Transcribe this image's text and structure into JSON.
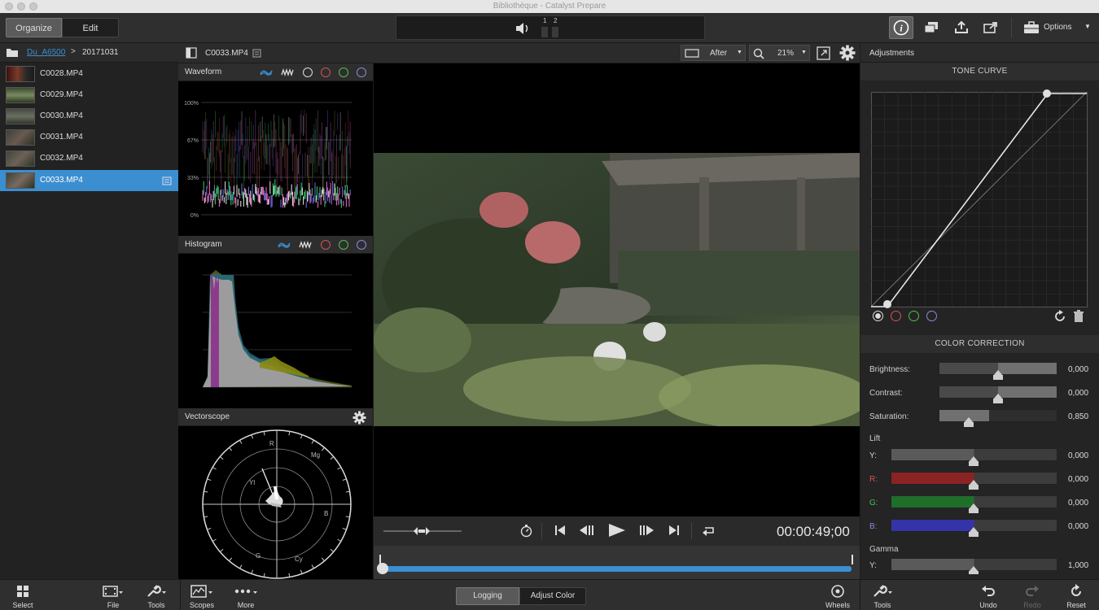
{
  "window": {
    "title": "Bibliothèque - Catalyst Prepare"
  },
  "toolbar": {
    "organize_label": "Organize",
    "edit_label": "Edit",
    "meter_labels": [
      "1",
      "2"
    ],
    "options_label": "Options"
  },
  "browser": {
    "breadcrumb": {
      "folder": "Du_A6500",
      "subfolder": "20171031"
    },
    "files": [
      {
        "name": "C0028.MP4"
      },
      {
        "name": "C0029.MP4"
      },
      {
        "name": "C0030.MP4"
      },
      {
        "name": "C0031.MP4"
      },
      {
        "name": "C0032.MP4"
      },
      {
        "name": "C0033.MP4",
        "selected": true
      }
    ]
  },
  "viewer_bar": {
    "clip_name": "C0033.MP4",
    "view_mode": "After",
    "zoom": "21%"
  },
  "scopes": {
    "waveform": {
      "title": "Waveform",
      "scale": [
        "100%",
        "67%",
        "33%",
        "0%"
      ]
    },
    "histogram": {
      "title": "Histogram"
    },
    "vectorscope": {
      "title": "Vectorscope",
      "targets": [
        "R",
        "Mg",
        "B",
        "Cy",
        "G",
        "Yl"
      ]
    }
  },
  "transport": {
    "timecode": "00:00:49;00"
  },
  "adjustments": {
    "title": "Adjustments",
    "tone_curve": {
      "title": "TONE CURVE"
    },
    "color_correction": {
      "title": "COLOR CORRECTION",
      "brightness": {
        "label": "Brightness:",
        "value": "0,000"
      },
      "contrast": {
        "label": "Contrast:",
        "value": "0,000"
      },
      "saturation": {
        "label": "Saturation:",
        "value": "0,850",
        "level": 0.85
      }
    },
    "lift": {
      "title": "Lift",
      "y": {
        "label": "Y:",
        "value": "0,000"
      },
      "r": {
        "label": "R:",
        "value": "0,000"
      },
      "g": {
        "label": "G:",
        "value": "0,000"
      },
      "b": {
        "label": "B:",
        "value": "0,000"
      }
    },
    "gamma": {
      "title": "Gamma",
      "y": {
        "label": "Y:",
        "value": "1,000"
      }
    }
  },
  "bottom_bar": {
    "select": "Select",
    "file": "File",
    "tools": "Tools",
    "scopes": "Scopes",
    "more": "More",
    "logging": "Logging",
    "adjust_color": "Adjust Color",
    "wheels": "Wheels",
    "tools_right": "Tools",
    "undo": "Undo",
    "redo": "Redo",
    "reset": "Reset"
  },
  "colors": {
    "accent": "#3b8ed0",
    "lift_r": "#8a2424",
    "lift_g": "#1f6e2a",
    "lift_b": "#3434a8"
  }
}
